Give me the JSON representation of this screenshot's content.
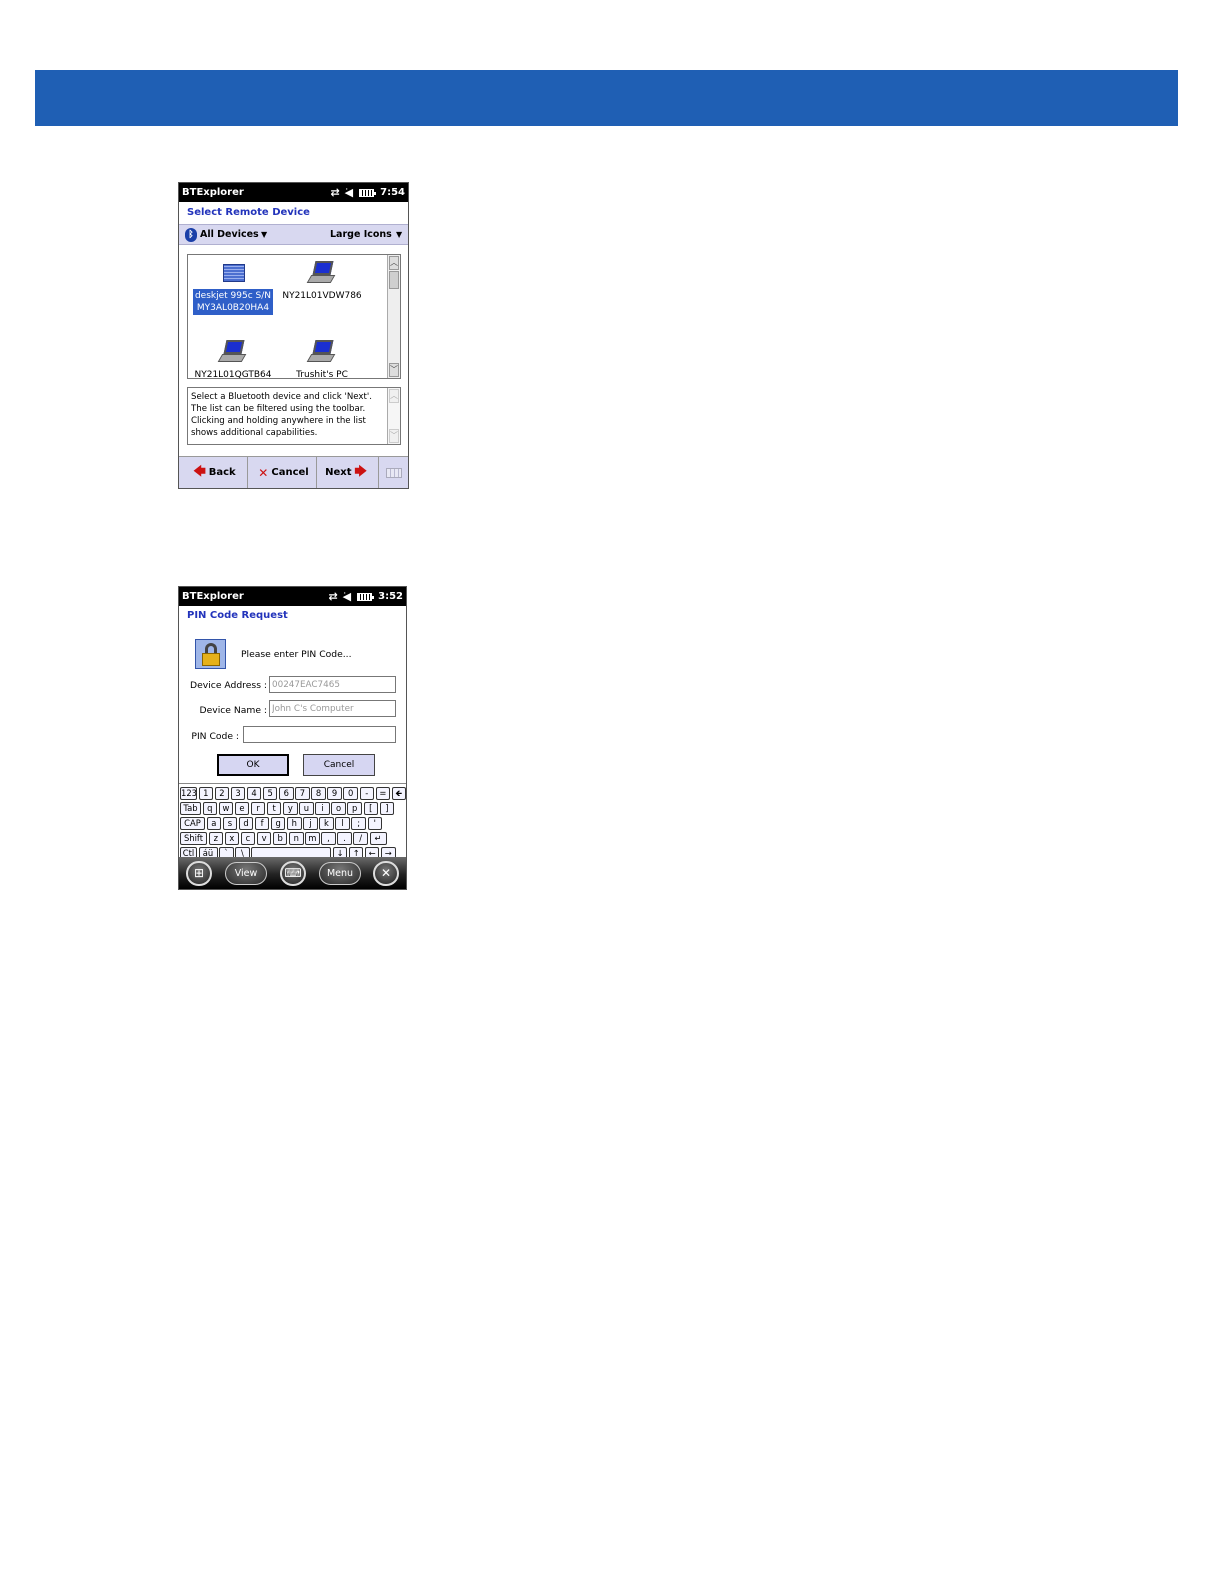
{
  "screen1": {
    "statusbar": {
      "app_title": "BTExplorer",
      "time": "7:54"
    },
    "dialog_title": "Select Remote Device",
    "filter": {
      "selected": "All Devices",
      "view": "Large Icons"
    },
    "devices": [
      {
        "label_line1": "deskjet 995c S/N",
        "label_line2": "MY3AL0B20HA4",
        "icon": "printer-icon",
        "selected": true
      },
      {
        "label_line1": "NY21L01VDW786",
        "label_line2": "",
        "icon": "laptop-icon",
        "selected": false
      },
      {
        "label_line1": "NY21L01QGTB64",
        "label_line2": "",
        "icon": "laptop-icon",
        "selected": false
      },
      {
        "label_line1": "Trushit's PC",
        "label_line2": "",
        "icon": "laptop-icon",
        "selected": false
      }
    ],
    "help_text": "Select a Bluetooth device and click 'Next'. The list can be filtered using the toolbar. Clicking and holding anywhere in the list shows additional capabilities.",
    "wizard": {
      "back_label": "Back",
      "cancel_label": "Cancel",
      "next_label": "Next"
    }
  },
  "screen2": {
    "statusbar": {
      "app_title": "BTExplorer",
      "time": "3:52"
    },
    "dialog_title": "PIN Code Request",
    "prompt": "Please enter PIN Code...",
    "fields": {
      "address_label": "Device Address :",
      "address_value": "00247EAC7465",
      "name_label": "Device Name :",
      "name_value": "John C's Computer",
      "pin_label": "PIN Code :",
      "pin_value": ""
    },
    "buttons": {
      "ok_label": "OK",
      "cancel_label": "Cancel"
    },
    "keyboard_rows": [
      [
        "123",
        "1",
        "2",
        "3",
        "4",
        "5",
        "6",
        "7",
        "8",
        "9",
        "0",
        "-",
        "=",
        "🡸"
      ],
      [
        "Tab",
        "q",
        "w",
        "e",
        "r",
        "t",
        "y",
        "u",
        "i",
        "o",
        "p",
        "[",
        "]"
      ],
      [
        "CAP",
        "a",
        "s",
        "d",
        "f",
        "g",
        "h",
        "j",
        "k",
        "l",
        ";",
        "'"
      ],
      [
        "Shift",
        "z",
        "x",
        "c",
        "v",
        "b",
        "n",
        "m",
        ",",
        ".",
        "/",
        "↵"
      ],
      [
        "Ctl",
        "áü",
        "`",
        "\\",
        " ",
        "↓",
        "↑",
        "←",
        "→"
      ]
    ],
    "taskbar": {
      "view_label": "View",
      "menu_label": "Menu"
    }
  },
  "colors": {
    "banner": "#1f5fb4",
    "title_text": "#2233bb",
    "toolbar_bg": "#d8d8f0",
    "selection": "#2f5fc8"
  }
}
